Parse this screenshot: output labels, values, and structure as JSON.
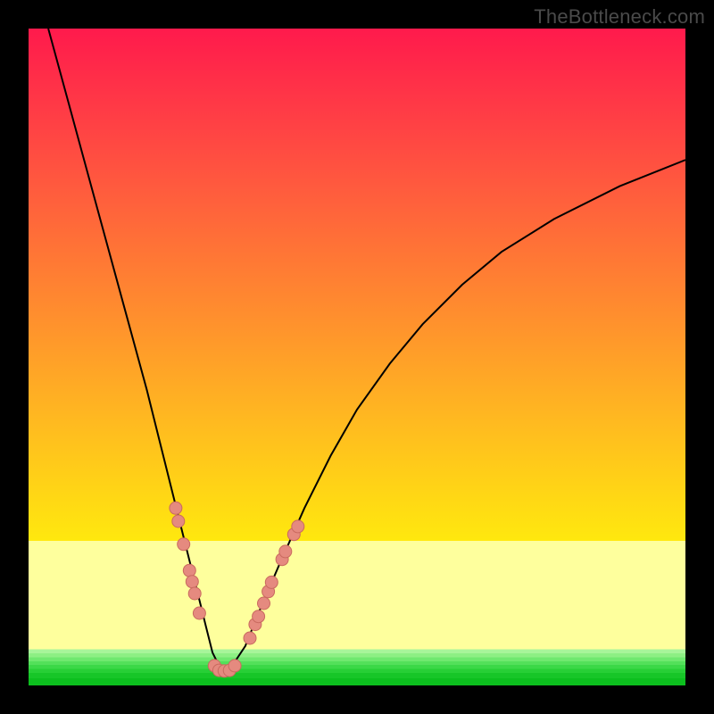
{
  "watermark": "TheBottleneck.com",
  "colors": {
    "dot_fill": "#e58a7f",
    "dot_stroke": "#c96a5f",
    "curve": "#000000"
  },
  "chart_data": {
    "type": "line",
    "title": "",
    "xlabel": "",
    "ylabel": "",
    "xlim": [
      0,
      100
    ],
    "ylim": [
      0,
      100
    ],
    "background": "heatmap-red-yellow-green",
    "series": [
      {
        "name": "bottleneck-curve",
        "x": [
          3,
          6,
          9,
          12,
          15,
          18,
          20,
          22,
          24,
          26,
          27,
          28,
          29,
          30,
          31,
          33,
          35,
          38,
          42,
          46,
          50,
          55,
          60,
          66,
          72,
          80,
          90,
          100
        ],
        "values": [
          100,
          89,
          78,
          67,
          56,
          45,
          37,
          29,
          21,
          13,
          9,
          5,
          3,
          2,
          3,
          6,
          11,
          18,
          27,
          35,
          42,
          49,
          55,
          61,
          66,
          71,
          76,
          80
        ]
      }
    ],
    "points": [
      {
        "x": 22.4,
        "y": 27.0
      },
      {
        "x": 22.8,
        "y": 25.0
      },
      {
        "x": 23.6,
        "y": 21.5
      },
      {
        "x": 24.5,
        "y": 17.5
      },
      {
        "x": 24.9,
        "y": 15.8
      },
      {
        "x": 25.3,
        "y": 14.0
      },
      {
        "x": 26.0,
        "y": 11.0
      },
      {
        "x": 28.3,
        "y": 3.0
      },
      {
        "x": 29.0,
        "y": 2.3
      },
      {
        "x": 29.8,
        "y": 2.2
      },
      {
        "x": 30.6,
        "y": 2.3
      },
      {
        "x": 31.4,
        "y": 3.0
      },
      {
        "x": 33.7,
        "y": 7.2
      },
      {
        "x": 34.5,
        "y": 9.3
      },
      {
        "x": 35.0,
        "y": 10.5
      },
      {
        "x": 35.8,
        "y": 12.5
      },
      {
        "x": 36.5,
        "y": 14.3
      },
      {
        "x": 37.0,
        "y": 15.7
      },
      {
        "x": 38.6,
        "y": 19.2
      },
      {
        "x": 39.1,
        "y": 20.4
      },
      {
        "x": 40.4,
        "y": 23.0
      },
      {
        "x": 41.0,
        "y": 24.2
      }
    ]
  }
}
